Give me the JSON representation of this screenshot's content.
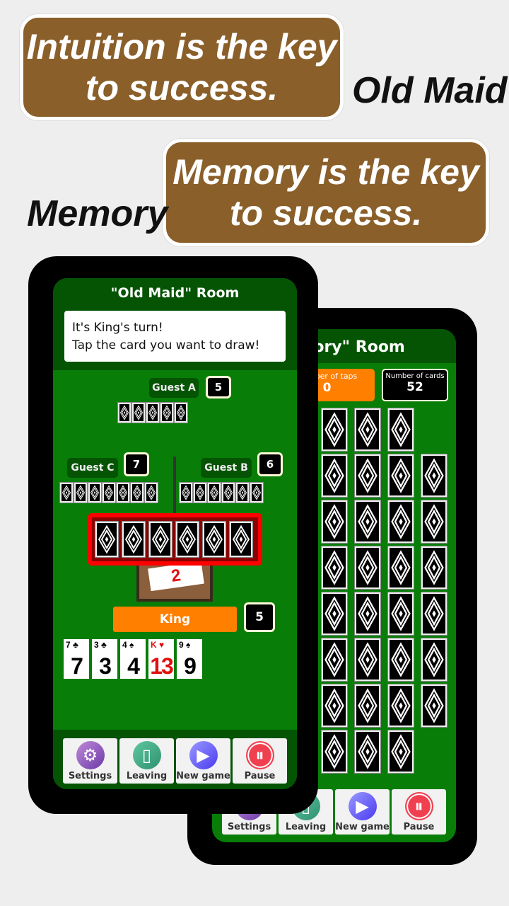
{
  "promo": {
    "banner_top": [
      "Intuition is the key",
      "to success."
    ],
    "tag_top": "Old Maid",
    "banner_mid": [
      "Memory is the key",
      "to success."
    ],
    "tag_mid": "Memory"
  },
  "memory": {
    "title": "\"Memory\" Room",
    "taps_label": "Number of taps",
    "taps_value": "0",
    "cards_label": "Number of cards",
    "cards_value": "52",
    "grid_rows": [
      3,
      4,
      4,
      4,
      4,
      4,
      4,
      3
    ],
    "buttons": [
      {
        "label": "Settings",
        "icon": "gear-icon"
      },
      {
        "label": "Leaving",
        "icon": "door-icon"
      },
      {
        "label": "New game",
        "icon": "play-icon"
      },
      {
        "label": "Pause",
        "icon": "pause-icon"
      }
    ]
  },
  "oldmaid": {
    "title": "\"Old Maid\" Room",
    "message": [
      "It's King's turn!",
      "Tap the card you want to draw!"
    ],
    "players": {
      "guest_a": {
        "name": "Guest A",
        "count": "5"
      },
      "guest_b": {
        "name": "Guest B",
        "count": "6"
      },
      "guest_c": {
        "name": "Guest C",
        "count": "7"
      },
      "king": {
        "name": "King",
        "count": "5"
      }
    },
    "selected_hand_count": 6,
    "hand": [
      {
        "rank": "7",
        "suit": "♣",
        "value": "7",
        "color": "#000000"
      },
      {
        "rank": "3",
        "suit": "♣",
        "value": "3",
        "color": "#000000"
      },
      {
        "rank": "4",
        "suit": "♠",
        "value": "4",
        "color": "#000000"
      },
      {
        "rank": "K",
        "suit": "♥",
        "value": "13",
        "color": "#e01010"
      },
      {
        "rank": "9",
        "suit": "♠",
        "value": "9",
        "color": "#000000"
      }
    ],
    "buttons": [
      {
        "label": "Settings",
        "icon": "gear-icon"
      },
      {
        "label": "Leaving",
        "icon": "door-icon"
      },
      {
        "label": "New game",
        "icon": "play-icon"
      },
      {
        "label": "Pause",
        "icon": "pause-icon"
      }
    ]
  },
  "colors": {
    "table_green": "#087d08",
    "header_green": "#045404",
    "banner_brown": "#8a5f2a",
    "accent_orange": "#ff7f00",
    "highlight_red": "#ff0000"
  }
}
